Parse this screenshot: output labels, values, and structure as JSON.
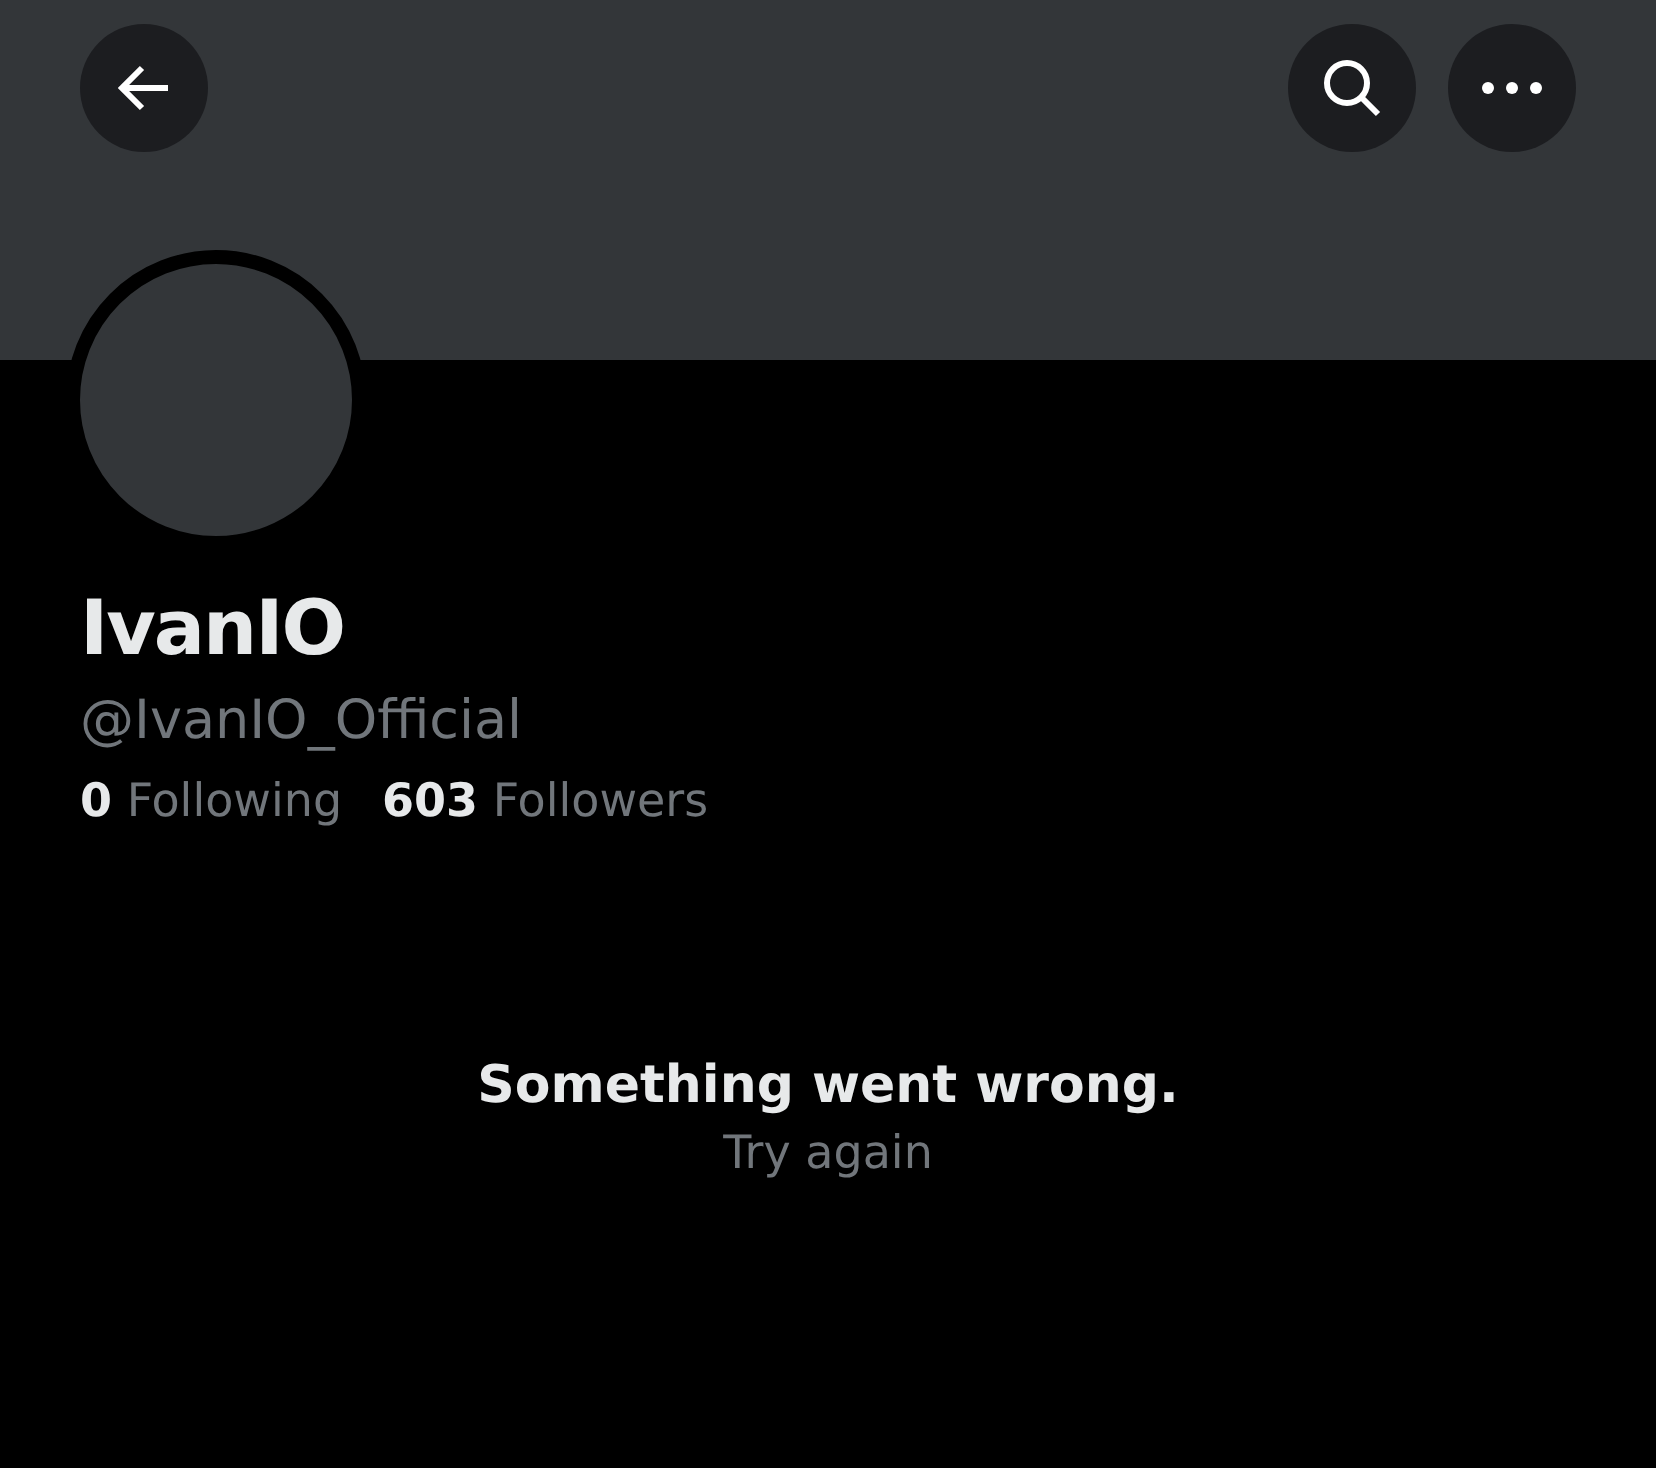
{
  "header": {
    "buttons": [
      {
        "kind": "back"
      },
      {
        "kind": "search"
      },
      {
        "kind": "more"
      }
    ]
  },
  "profile": {
    "name": "IvanIO",
    "handle": "@IvanIO_Official",
    "stats": [
      "**0** Following",
      "**603** Followers"
    ]
  },
  "error": {
    "message": "Something went wrong.",
    "action": "Try again"
  }
}
